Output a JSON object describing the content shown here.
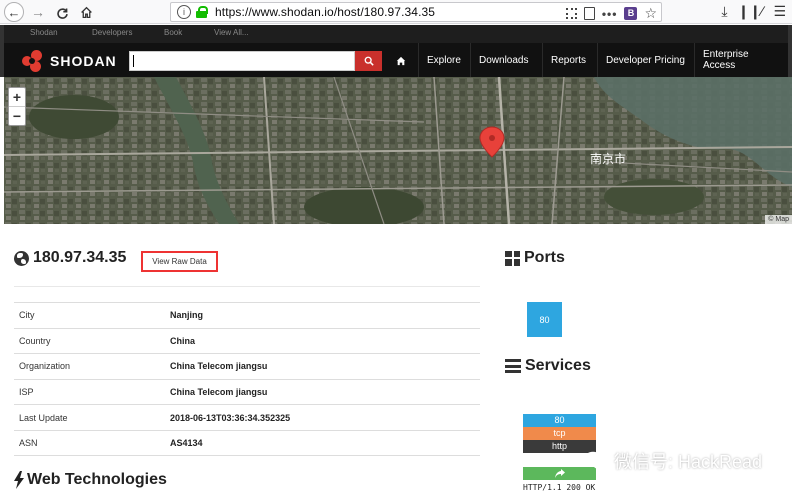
{
  "browser": {
    "url": "https://www.shodan.io/host/180.97.34.35",
    "reload_icon": "reload-icon",
    "info_glyph": "i"
  },
  "topbar": {
    "links": [
      "Shodan",
      "Developers",
      "Book",
      "View All..."
    ]
  },
  "header": {
    "logo_text": "SHODAN",
    "search_value": "",
    "menu": [
      "Explore",
      "Downloads",
      "Reports",
      "Developer Pricing",
      "Enterprise Access"
    ]
  },
  "map": {
    "zoom_in": "+",
    "zoom_out": "−",
    "city_label": "南京市",
    "attribution": "© Map"
  },
  "host": {
    "ip": "180.97.34.35",
    "raw_data_label": "View Raw Data",
    "details": [
      {
        "key": "City",
        "value": "Nanjing"
      },
      {
        "key": "Country",
        "value": "China"
      },
      {
        "key": "Organization",
        "value": "China Telecom jiangsu"
      },
      {
        "key": "ISP",
        "value": "China Telecom jiangsu"
      },
      {
        "key": "Last Update",
        "value": "2018-06-13T03:36:34.352325"
      },
      {
        "key": "ASN",
        "value": "AS4134"
      }
    ],
    "web_tech_title": "Web Technologies"
  },
  "ports": {
    "title": "Ports",
    "list": [
      "80"
    ]
  },
  "services": {
    "title": "Services",
    "port": "80",
    "protocol": "tcp",
    "name": "http",
    "response_line": "HTTP/1.1 200 OK"
  },
  "watermark": {
    "text": "微信号: HackRead"
  },
  "colors": {
    "accent_red": "#c9302c",
    "port_blue": "#2ea6e0",
    "proto_orange": "#f08a4b",
    "share_green": "#5cb85c"
  }
}
